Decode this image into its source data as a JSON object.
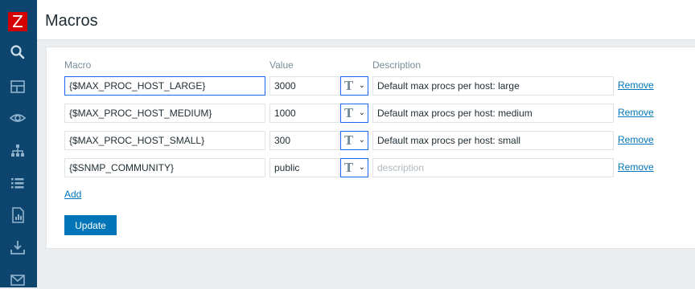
{
  "logo": {
    "letter": "Z"
  },
  "sidebar": {
    "icons": [
      "search-icon",
      "dashboard-icon",
      "monitoring-icon",
      "inventory-icon",
      "list-icon",
      "reports-icon",
      "download-icon",
      "mail-icon"
    ]
  },
  "header": {
    "title": "Macros"
  },
  "table": {
    "columns": {
      "macro": "Macro",
      "value": "Value",
      "description": "Description"
    },
    "rows": [
      {
        "macro": "{$MAX_PROC_HOST_LARGE}",
        "value": "3000",
        "description": "Default max procs per host: large",
        "description_placeholder": "description",
        "remove": "Remove"
      },
      {
        "macro": "{$MAX_PROC_HOST_MEDIUM}",
        "value": "1000",
        "description": "Default max procs per host: medium",
        "description_placeholder": "description",
        "remove": "Remove"
      },
      {
        "macro": "{$MAX_PROC_HOST_SMALL}",
        "value": "300",
        "description": "Default max procs per host: small",
        "description_placeholder": "description",
        "remove": "Remove"
      },
      {
        "macro": "{$SNMP_COMMUNITY}",
        "value": "public",
        "description": "",
        "description_placeholder": "description",
        "remove": "Remove"
      }
    ],
    "type_symbol": "T",
    "add_label": "Add"
  },
  "actions": {
    "update_label": "Update"
  },
  "colors": {
    "sidebar": "#0d456e",
    "logo": "#d40000",
    "link": "#0275b8",
    "focus_border": "#1f65f4"
  }
}
